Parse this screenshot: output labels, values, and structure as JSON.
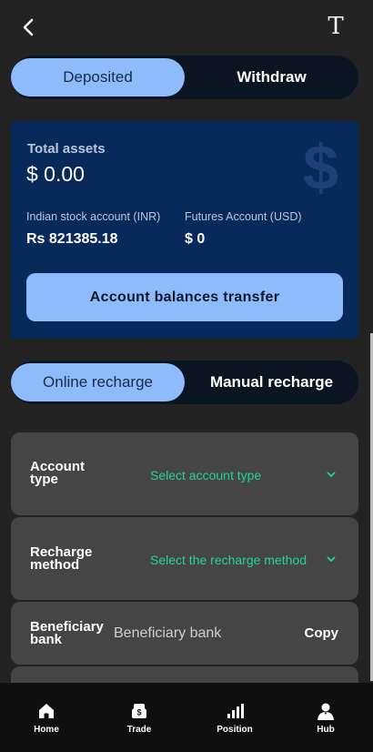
{
  "header": {
    "font_button_label": "T"
  },
  "top_segment": {
    "left_label": "Deposited",
    "right_label": "Withdraw",
    "active": "left"
  },
  "assets": {
    "total_label": "Total assets",
    "total_value": "$ 0.00",
    "watermark": "$",
    "indian_label": "Indian stock account (INR)",
    "indian_value": "Rs 821385.18",
    "futures_label": "Futures Account (USD)",
    "futures_value": "$ 0",
    "transfer_button": "Account balances transfer"
  },
  "recharge_segment": {
    "left_label": "Online recharge",
    "right_label": "Manual recharge",
    "active": "left"
  },
  "form": {
    "account_type_label_1": "Account",
    "account_type_label_2": "type",
    "account_type_value": "Select account type",
    "recharge_method_label_1": "Recharge",
    "recharge_method_label_2": "method",
    "recharge_method_value": "Select the recharge method",
    "beneficiary_label_1": "Beneficiary",
    "beneficiary_label_2": "bank",
    "beneficiary_value": "Beneficiary bank",
    "copy_label": "Copy"
  },
  "tabbar": {
    "items": [
      {
        "label": "Home",
        "icon": "home-icon"
      },
      {
        "label": "Trade",
        "icon": "trade-icon"
      },
      {
        "label": "Position",
        "icon": "position-icon"
      },
      {
        "label": "Hub",
        "icon": "hub-icon"
      }
    ]
  },
  "colors": {
    "background": "#232323",
    "accent": "#8dbbfb",
    "assets_card": "#082a5a",
    "select_text": "#22d39a",
    "form_row": "#454545"
  }
}
